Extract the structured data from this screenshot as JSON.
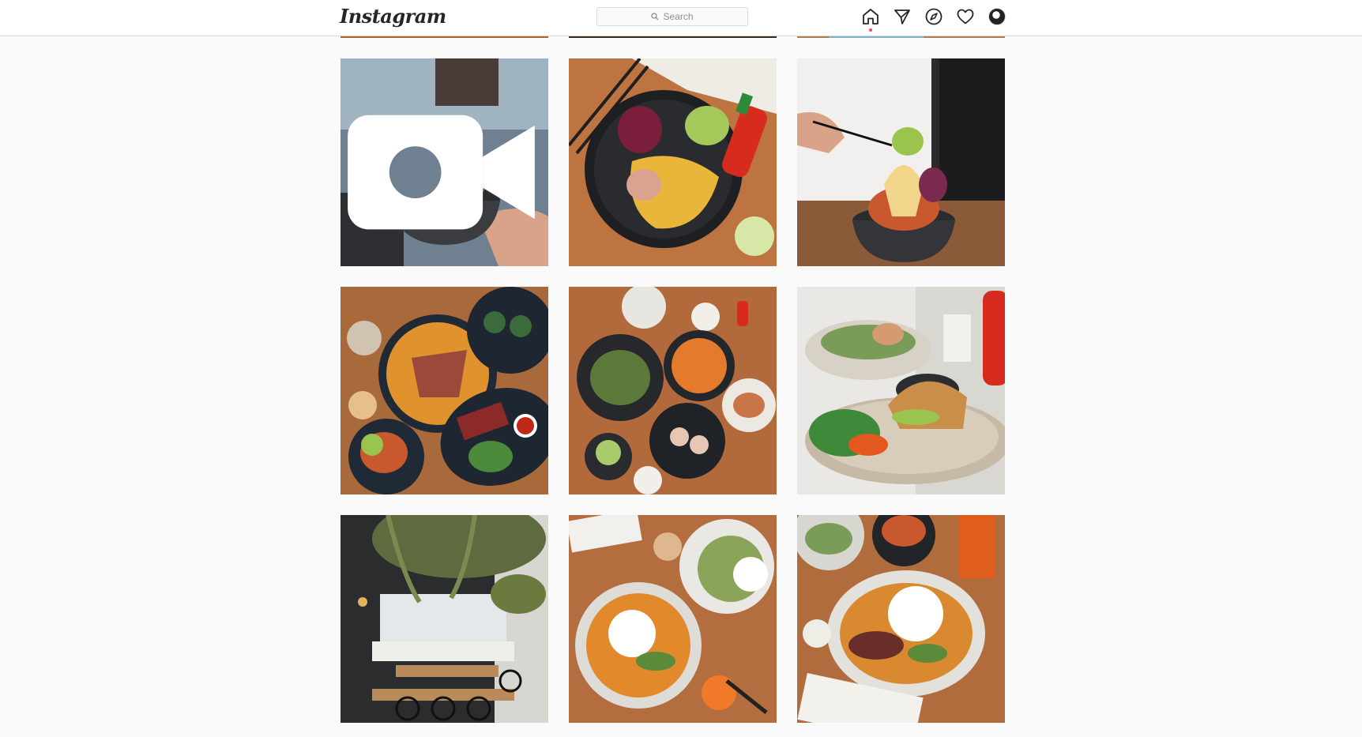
{
  "app": {
    "logo_text": "Instagram"
  },
  "search": {
    "placeholder": "Search"
  },
  "nav": {
    "items": [
      {
        "name": "home-icon"
      },
      {
        "name": "direct-icon"
      },
      {
        "name": "explore-icon"
      },
      {
        "name": "activity-heart-icon"
      },
      {
        "name": "profile-avatar"
      }
    ]
  },
  "colors": {
    "header_bg": "#ffffff",
    "page_bg": "#fafafa",
    "border": "#dbdbdb",
    "notification_dot": "#ed4956"
  },
  "grid": {
    "posts": [
      {
        "subject": "bowl-held-in-hand",
        "video": true
      },
      {
        "subject": "omelette-plate-with-sriracha",
        "video": false
      },
      {
        "subject": "chopsticks-over-bowl",
        "video": false
      },
      {
        "subject": "table-spread-curry",
        "video": false
      },
      {
        "subject": "table-spread-salads",
        "video": false
      },
      {
        "subject": "soft-shell-crab-bun",
        "video": false
      },
      {
        "subject": "restaurant-interior",
        "video": false
      },
      {
        "subject": "curry-with-rice",
        "video": false
      },
      {
        "subject": "curry-rice-bowl",
        "video": false
      }
    ]
  }
}
